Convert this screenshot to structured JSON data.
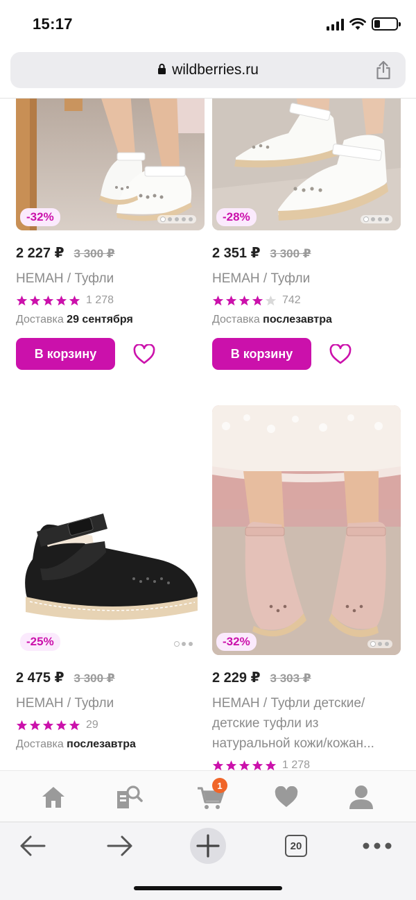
{
  "status_bar": {
    "time": "15:17"
  },
  "browser": {
    "url": "wildberries.ru",
    "tabs_count": "20"
  },
  "products": [
    {
      "discount": "-32%",
      "price": "2 227 ₽",
      "old_price": "3 300 ₽",
      "title": "НЕМАН / Туфли",
      "rating": 5,
      "reviews": "1 278",
      "delivery_label": "Доставка",
      "delivery_date": "29 сентября",
      "cart_label": "В корзину",
      "image": "white-shoes-on-feet",
      "dots": 5,
      "active_dot": 0
    },
    {
      "discount": "-28%",
      "price": "2 351 ₽",
      "old_price": "3 300 ₽",
      "title": "НЕМАН / Туфли",
      "rating": 4,
      "reviews": "742",
      "delivery_label": "Доставка",
      "delivery_date": "послезавтра",
      "cart_label": "В корзину",
      "image": "white-shoes-closeup",
      "dots": 4,
      "active_dot": 0
    },
    {
      "discount": "-25%",
      "price": "2 475 ₽",
      "old_price": "3 300 ₽",
      "title": "НЕМАН / Туфли",
      "rating": 5,
      "reviews": "29",
      "delivery_label": "Доставка",
      "delivery_date": "послезавтра",
      "image": "black-shoe-product",
      "dots": 3,
      "active_dot": 0
    },
    {
      "discount": "-32%",
      "price": "2 229 ₽",
      "old_price": "3 303 ₽",
      "title": "НЕМАН / Туфли детские/ детские туфли из натуральной кожи/кожан...",
      "rating": 5,
      "reviews": "1 278",
      "image": "pink-shoes-on-feet",
      "dots": 3,
      "active_dot": 0
    }
  ],
  "app_nav": {
    "items": [
      "home-icon",
      "catalog-search-icon",
      "cart-icon",
      "favorites-icon",
      "profile-icon"
    ],
    "cart_count": "1"
  },
  "colors": {
    "accent": "#cb11ab",
    "badge_bg": "#fbeafd",
    "cart_badge": "#f06528",
    "star_empty": "#d9d9d9"
  }
}
